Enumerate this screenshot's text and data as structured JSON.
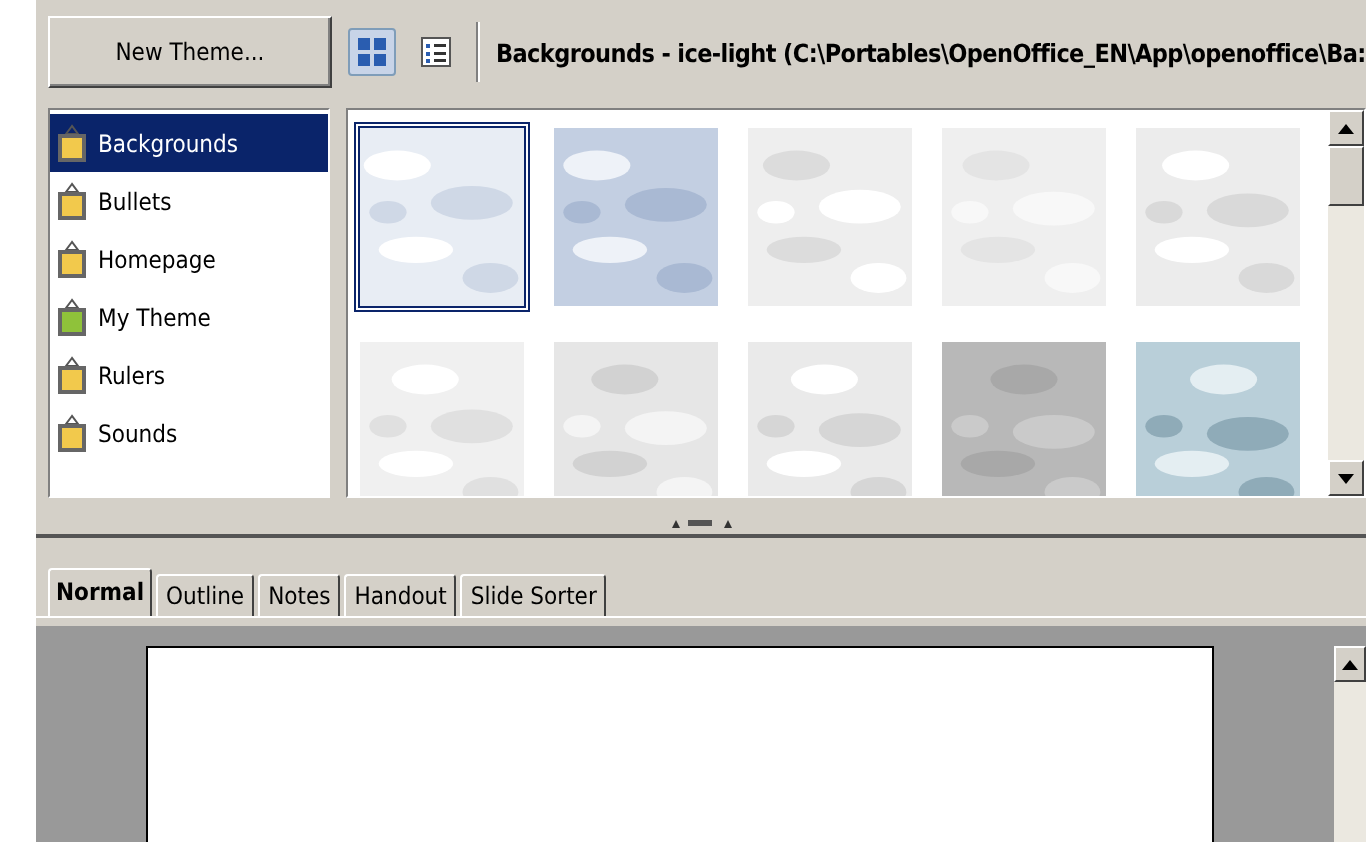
{
  "toolbar": {
    "new_theme_button": "New Theme...",
    "view_buttons": [
      {
        "kind": "icons",
        "selected": true
      },
      {
        "kind": "details",
        "selected": false
      }
    ],
    "path": "Backgrounds - ice-light (C:\\Portables\\OpenOffice_EN\\App\\openoffice\\Ba:"
  },
  "themes": [
    {
      "label": "Backgrounds",
      "selected": true,
      "color": "#f2c94c"
    },
    {
      "label": "Bullets",
      "selected": false,
      "color": "#f2c94c"
    },
    {
      "label": "Homepage",
      "selected": false,
      "color": "#f2c94c"
    },
    {
      "label": "My Theme",
      "selected": false,
      "color": "#8fc23a"
    },
    {
      "label": "Rulers",
      "selected": false,
      "color": "#f2c94c"
    },
    {
      "label": "Sounds",
      "selected": false,
      "color": "#f2c94c"
    }
  ],
  "gallery": [
    {
      "kind": "picture",
      "selected": true
    },
    {
      "kind": "picture",
      "selected": false
    },
    {
      "kind": "picture",
      "selected": false
    },
    {
      "kind": "picture",
      "selected": false
    },
    {
      "kind": "picture",
      "selected": false
    },
    {
      "kind": "picture",
      "selected": false
    },
    {
      "kind": "picture",
      "selected": false
    },
    {
      "kind": "picture",
      "selected": false
    },
    {
      "kind": "picture",
      "selected": false
    },
    {
      "kind": "picture",
      "selected": false
    }
  ],
  "view_tabs": [
    {
      "label": "Normal",
      "selected": true
    },
    {
      "label": "Outline",
      "selected": false
    },
    {
      "label": "Notes",
      "selected": false
    },
    {
      "label": "Handout",
      "selected": false
    },
    {
      "label": "Slide Sorter",
      "selected": false
    }
  ]
}
